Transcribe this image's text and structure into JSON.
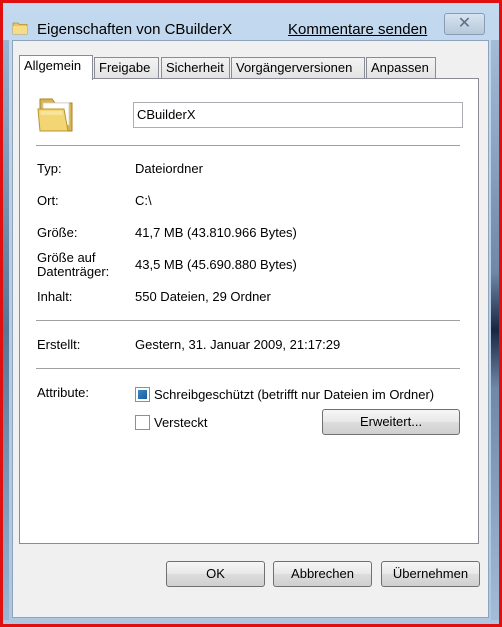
{
  "window": {
    "title": "Eigenschaften von CBuilderX",
    "feedback_link": "Kommentare senden",
    "close_glyph": "✕"
  },
  "tabs": [
    {
      "label": "Allgemein",
      "active": true
    },
    {
      "label": "Freigabe",
      "active": false
    },
    {
      "label": "Sicherheit",
      "active": false
    },
    {
      "label": "Vorgängerversionen",
      "active": false
    },
    {
      "label": "Anpassen",
      "active": false
    }
  ],
  "general": {
    "folder_icon": "folder-icon",
    "name_value": "CBuilderX",
    "type": {
      "label": "Typ:",
      "value": "Dateiordner"
    },
    "location": {
      "label": "Ort:",
      "value": "C:\\"
    },
    "size": {
      "label": "Größe:",
      "value": "41,7 MB (43.810.966 Bytes)"
    },
    "size_on_disk": {
      "label_line1": "Größe auf",
      "label_line2": "Datenträger:",
      "value": "43,5 MB (45.690.880 Bytes)"
    },
    "contents": {
      "label": "Inhalt:",
      "value": "550 Dateien, 29 Ordner"
    },
    "created": {
      "label": "Erstellt:",
      "value": "Gestern, 31. Januar 2009, 21:17:29"
    },
    "attributes": {
      "label": "Attribute:",
      "readonly": {
        "label": "Schreibgeschützt (betrifft nur Dateien im Ordner)",
        "state": "indeterminate"
      },
      "hidden": {
        "label": "Versteckt",
        "state": "unchecked"
      },
      "advanced_button": "Erweitert..."
    }
  },
  "buttons": {
    "ok": "OK",
    "cancel": "Abbrechen",
    "apply": "Übernehmen"
  },
  "colors": {
    "frame_red": "#e01010",
    "aero_blue": "#b7cee6",
    "checkbox_fill": "#1a5e9c"
  }
}
